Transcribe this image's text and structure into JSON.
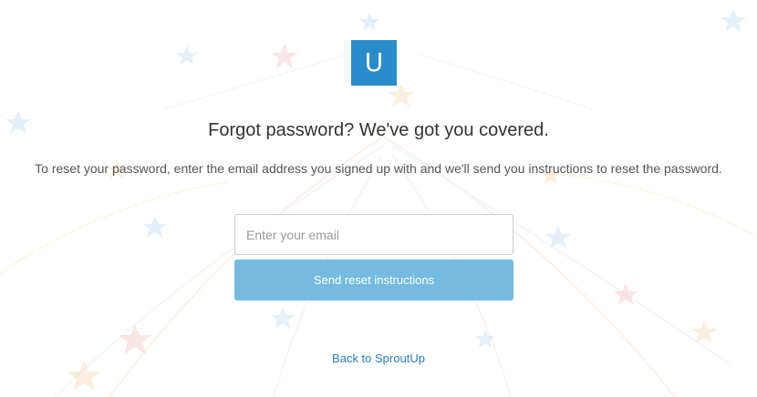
{
  "logo": {
    "letter": "U"
  },
  "heading": "Forgot password? We've got you covered.",
  "instructions": "To reset your password, enter the email address you signed up with and we'll send you instructions to reset the password.",
  "email_field": {
    "placeholder": "Enter your email",
    "value": ""
  },
  "send_button": {
    "label": "Send reset instructions"
  },
  "back_link": {
    "label": "Back to SproutUp"
  },
  "colors": {
    "brand": "#2a8cca",
    "button": "#74bbdf",
    "link": "#2a7fbf"
  }
}
